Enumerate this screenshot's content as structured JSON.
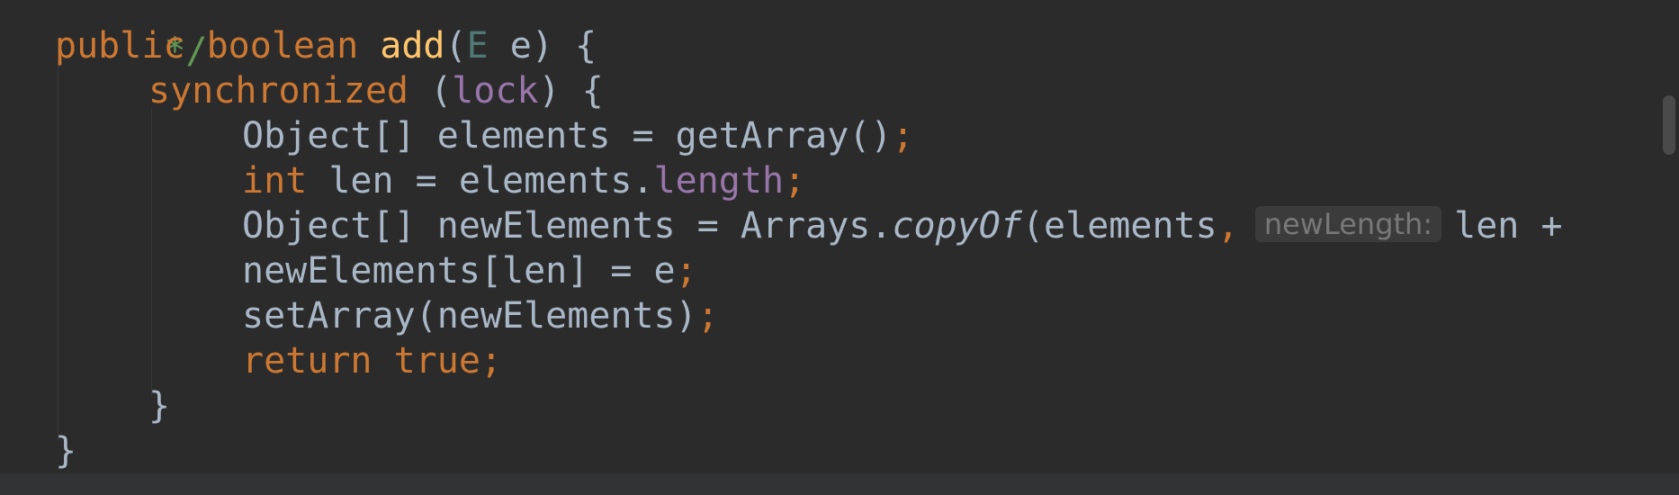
{
  "code": {
    "comment_end": "*/",
    "method_kw_public": "public",
    "method_kw_boolean": "boolean",
    "method_name": "add",
    "param_open": "(",
    "param_type": "E",
    "param_rest": " e) {",
    "sync_kw": "synchronized",
    "sync_open": "(",
    "sync_lock": "lock",
    "sync_close": ") {",
    "l1_text": "Object[] elements = getArray()",
    "l1_semi": ";",
    "l2_kw": "int",
    "l2_text": " len = elements.",
    "l2_field": "length",
    "l2_semi": ";",
    "l3_a": "Object[] newElements = Arrays.",
    "l3_method": "copyOf",
    "l3_b": "(elements",
    "l3_comma": ",",
    "l3_hint": "newLength:",
    "l3_c": "len +",
    "l4_text": "newElements[len] = e",
    "l4_semi": ";",
    "l5_text": "setArray(newElements)",
    "l5_semi": ";",
    "l6_return": "return",
    "l6_true": "true",
    "l6_semi": ";",
    "close_inner": "}",
    "close_outer": "}"
  },
  "colors": {
    "background": "#2b2b2b",
    "keyword": "#cc7832",
    "default_text": "#a9b7c6",
    "method_declaration": "#ffc66d",
    "type_parameter": "#507874",
    "field": "#9876aa",
    "doc_comment": "#629755",
    "inlay_hint": "#787878"
  }
}
